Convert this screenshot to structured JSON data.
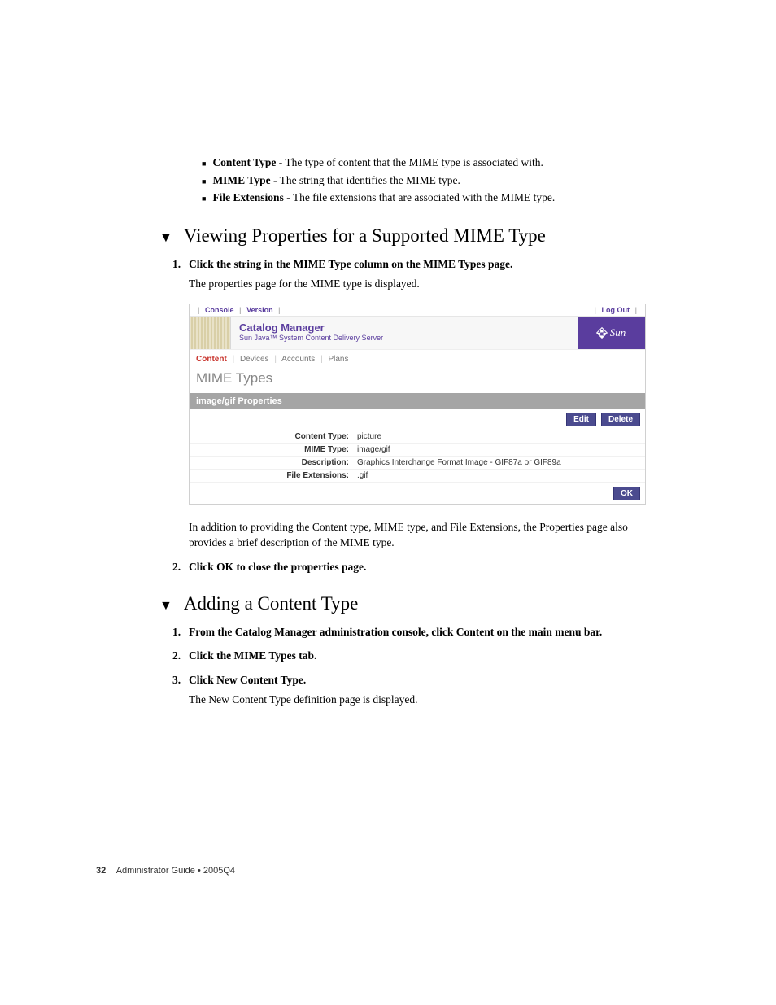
{
  "bullets": [
    {
      "term": "Content Type -",
      "desc": " The type of content that the MIME type is associated with."
    },
    {
      "term": "MIME Type -",
      "desc": " The string that identifies the MIME type."
    },
    {
      "term": "File Extensions -",
      "desc": " The file extensions that are associated with the MIME type."
    }
  ],
  "section1": {
    "heading": "Viewing Properties for a Supported MIME Type",
    "step1_bold": "Click the string in the MIME Type column on the MIME Types page.",
    "step1_follow": "The properties page for the MIME type is displayed.",
    "afterShot": "In addition to providing the Content type, MIME type, and File Extensions, the Properties page also provides a brief description of the MIME type.",
    "step2_bold": "Click OK to close the properties page."
  },
  "shot": {
    "topbar": {
      "console": "Console",
      "version": "Version",
      "logout": "Log Out"
    },
    "banner": {
      "title": "Catalog Manager",
      "sub": "Sun Java™ System Content Delivery Server",
      "brand": "Sun"
    },
    "menu": {
      "content": "Content",
      "devices": "Devices",
      "accounts": "Accounts",
      "plans": "Plans"
    },
    "pagetitle": "MIME Types",
    "greybar": "image/gif Properties",
    "buttons": {
      "edit": "Edit",
      "delete": "Delete",
      "ok": "OK"
    },
    "props": [
      {
        "label": "Content Type:",
        "value": "picture"
      },
      {
        "label": "MIME Type:",
        "value": "image/gif"
      },
      {
        "label": "Description:",
        "value": "Graphics Interchange Format Image - GIF87a or GIF89a"
      },
      {
        "label": "File Extensions:",
        "value": ".gif"
      }
    ]
  },
  "section2": {
    "heading": "Adding a Content Type",
    "step1_bold": "From the Catalog Manager administration console, click Content on the main menu bar.",
    "step2_bold": "Click the MIME Types tab.",
    "step3_bold": "Click New Content Type.",
    "step3_follow": "The New Content Type definition page is displayed."
  },
  "footer": {
    "page": "32",
    "text": "Administrator Guide  •  2005Q4"
  }
}
